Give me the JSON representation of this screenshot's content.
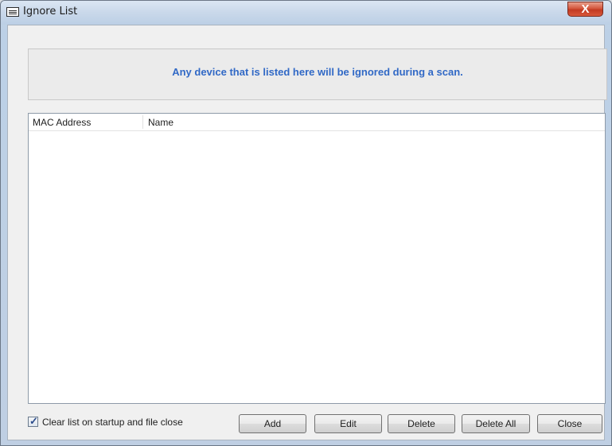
{
  "window": {
    "title": "Ignore List",
    "close_glyph": "X"
  },
  "banner": {
    "message": "Any device that is listed here will be ignored during a scan."
  },
  "list": {
    "columns": [
      "MAC Address",
      "Name"
    ],
    "rows": []
  },
  "options": {
    "clear_on_startup": {
      "label": "Clear list on startup and file close",
      "checked": true
    }
  },
  "buttons": {
    "add": "Add",
    "edit": "Edit",
    "delete": "Delete",
    "delete_all": "Delete All",
    "close": "Close"
  },
  "icons": {
    "window_icon": "window-icon",
    "close": "close-icon",
    "check": "checkmark-icon"
  },
  "colors": {
    "banner_text": "#3169c6",
    "close_button": "#c23a22"
  }
}
